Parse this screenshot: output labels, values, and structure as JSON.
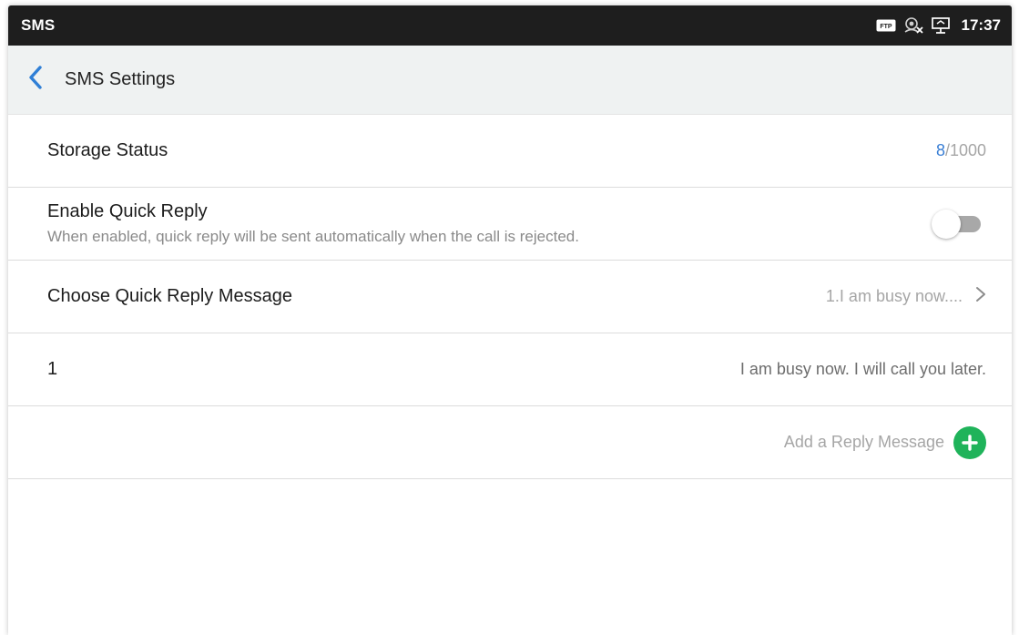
{
  "status_bar": {
    "app_name": "SMS",
    "time": "17:37",
    "icons": [
      "ftp-icon",
      "network-disconnected-icon",
      "screen-share-icon"
    ]
  },
  "header": {
    "title": "SMS Settings",
    "back_icon": "chevron-left-icon",
    "accent_color": "#2f7fd6"
  },
  "settings": {
    "storage": {
      "label": "Storage Status",
      "used": "8",
      "total": "/1000"
    },
    "quick_reply": {
      "label": "Enable Quick Reply",
      "description": "When enabled, quick reply will be sent automatically when the call is rejected.",
      "enabled": false
    },
    "choose_message": {
      "label": "Choose Quick Reply Message",
      "value": "1.I am busy now....",
      "chevron": ">"
    },
    "messages": [
      {
        "index": "1",
        "text": "I am busy now. I will call you later."
      }
    ],
    "add_message": {
      "label": "Add a Reply Message",
      "icon": "plus-icon",
      "color": "#1fb35a"
    }
  }
}
